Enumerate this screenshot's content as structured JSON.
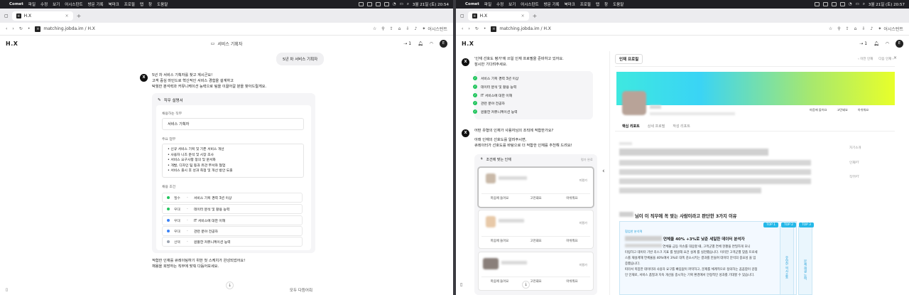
{
  "menubar": {
    "app": "Comet",
    "items": [
      "파일",
      "수정",
      "보기",
      "어시스턴트",
      "방문 기록",
      "북마크",
      "프로필",
      "탭",
      "창",
      "도움말"
    ],
    "time_left": "3월 21일 (토) 20:54",
    "time_right": "3월 21일 (토) 20:57"
  },
  "browser": {
    "tab_title": "H.X",
    "url": "matching.jobda.im / H.X",
    "assistant": "어시스턴트"
  },
  "app": {
    "logo": "H.X",
    "title": "서비스 기획자",
    "count": "1",
    "avatar": "E"
  },
  "left": {
    "user_msg": "5년 차 서비스 기획자",
    "bot_msg": [
      "5년 차 서비스 기획자를 찾고 계시군요!",
      "고객 중심 마인드로 혁신적인 서비스 경험을 설계하고",
      "탁월한 분석력과 커뮤니케이션 능력으로 팀을 이끌어갈 분을 찾아드릴게요."
    ],
    "card_title": "직무 설명서",
    "job_label": "채용하는 직무",
    "job_value": "서비스 기획자",
    "duty_label": "주요 업무",
    "duties": [
      "• 신규 서비스 기획 및 기존 서비스 개선",
      "• 사용자 니즈 분석 및 시장 조사",
      "• 서비스 요구사항 정의 및 문서화",
      "• 개발, 디자인 팀 등과 유관 부서와 협업",
      "• 서비스 출시 후 성과 측정 및 개선 방안 도출"
    ],
    "cond_label": "채용 조건",
    "conditions": [
      {
        "tag": "필수",
        "text": "서비스 기획 경력 3년 이상",
        "color": "#22c55e"
      },
      {
        "tag": "우대",
        "text": "데이터 분석 및 활용 능력",
        "color": "#22c55e"
      },
      {
        "tag": "우대",
        "text": "IT 서비스에 대한 이해",
        "color": "#3b82f6"
      },
      {
        "tag": "우대",
        "text": "관련 분야 전공자",
        "color": "#3b82f6"
      },
      {
        "tag": "선택",
        "text": "원활한 커뮤니케이션 능력",
        "color": "#9ca3af"
      }
    ],
    "closing": [
      "적합한 인재를 큐레이팅하기 위한 첫 스케치가 완성되었어요!",
      "채용을 희망하는 직무에 맞춰 다듬어보세요."
    ],
    "bottom_btn": "모두 다듬어줘"
  },
  "right": {
    "intro": [
      "'인재 선호도 평가'에 쓰일 인재 프로필을 준비하고 있어요.",
      "잠시만 기다려주세요."
    ],
    "checks": [
      "서비스 기획 경력 3년 이상",
      "데이터 분석 및 활용 능력",
      "IT 서비스에 대한 이해",
      "관련 분야 전공자",
      "원활한 커뮤니케이션 능력"
    ],
    "question": [
      "어떤 유형의 인재가 사용자님의 조직에 적합한가요?",
      "",
      "아래 인재의 선호도를 알려주시면,",
      "큐레이터가 선호도를 바탕으로 더 적합한 인재를 추천해 드려요!"
    ],
    "cand_header": "조건에 맞는 인재",
    "cand_sub": "평가 완료",
    "cand_badge": "미평가",
    "cand_actions": [
      "마음에 들어요",
      "고민돼요",
      "아쉬워요"
    ],
    "panel_tab": "인재 프로필",
    "nav_prev": "이전 인재",
    "nav_next": "다음 인재",
    "sub_tabs": [
      "핵심 리포트",
      "상세 프로필",
      "작성 리포트"
    ],
    "side_labels": [
      "자기소개",
      "인재PT",
      "직무PT"
    ],
    "reason_title": "님이 이 직무에 꼭 맞는 사람이라고 판단한 3가지 이유",
    "top_tags": [
      "TOP 1",
      "TOP 2",
      "TOP 3"
    ],
    "reason_small": "협업한 분석력",
    "reason_head": "연체율 40% +3%로 낮춘 세일한 데이터 분석자",
    "reason_body": [
      "연체율 급등 이슈를 대응할 때, 고객군별 연체 현황을 면밀하게 모니",
      "터링하고 데이터 기반 리스크 지표 를 발굴해 요건 설계 를 실천했습니다. 이러한 고객군별 맞춤 프로세",
      "스를 재설계해 연체율을 40%에서 3%로 대폭 감소시키는 결과를 만들며 데이터 분석의 중요성 을 입",
      "증했습니다.",
      "따라서 복잡한 데이터와 사용자 요구를 빠짐없이 파악하고, 문제를 체계적으로 정의하는 꼼꼼함이 강점",
      "인 인재로, 서비스 품질과 지속 개선을 중시하는 기획 환경에서 안정적인 성과를 기대할 수 있습니다."
    ],
    "strip2": "유연한 의사소통",
    "strip3": "문제 해결 능력"
  }
}
